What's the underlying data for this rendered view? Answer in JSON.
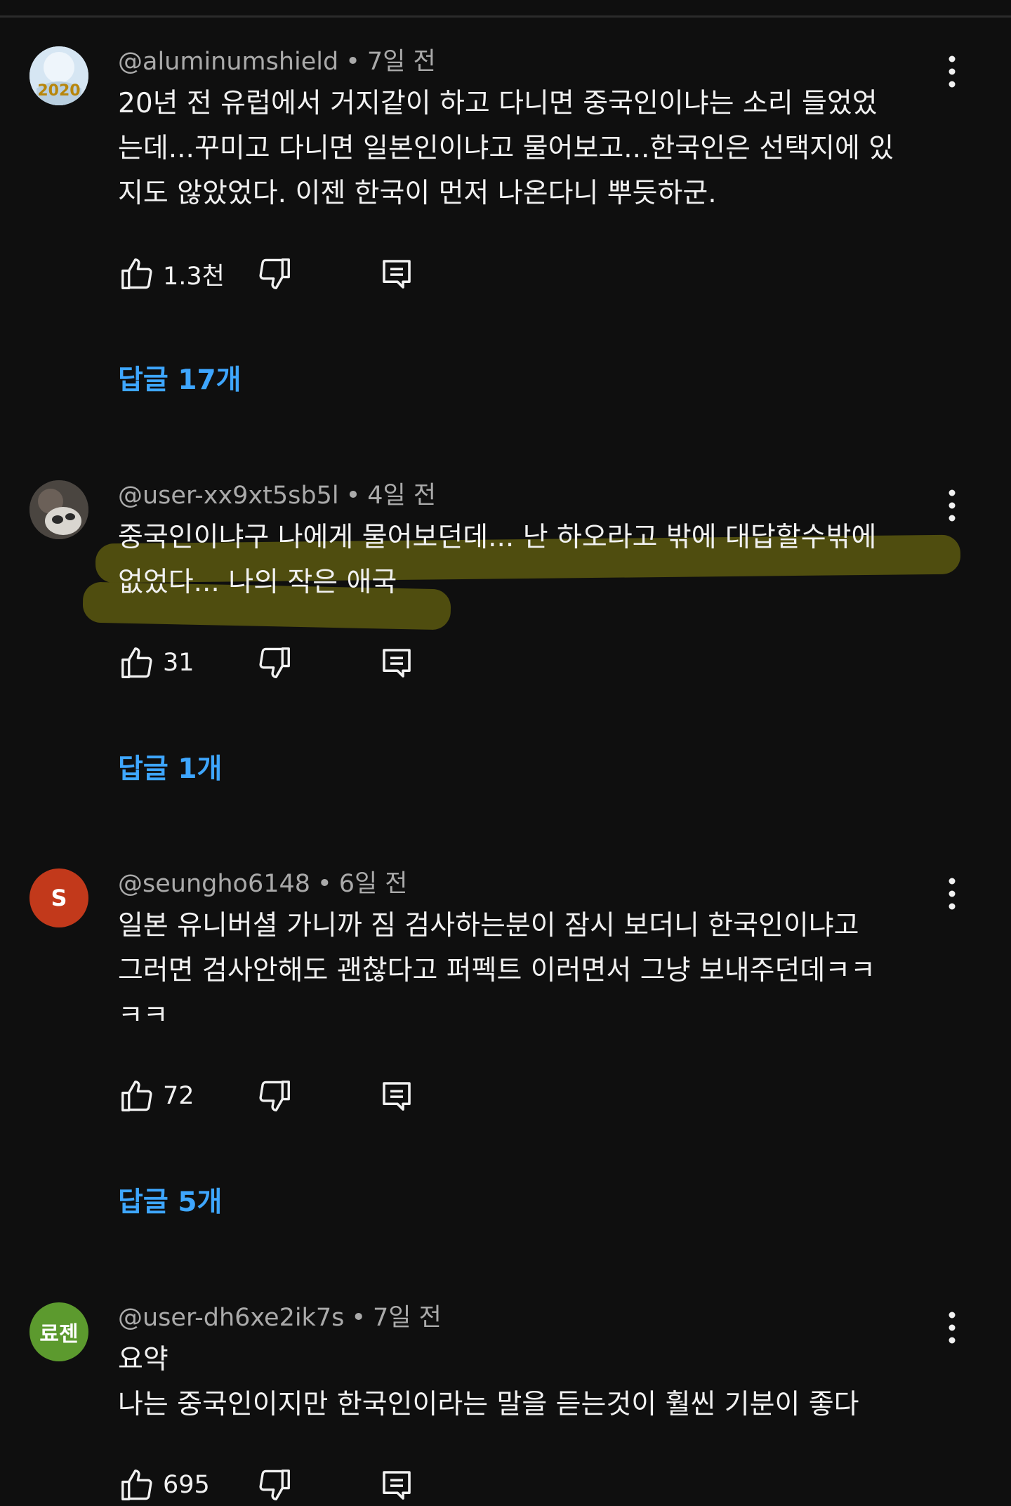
{
  "colors": {
    "background": "#0f0f0f",
    "text": "#f1f1f1",
    "meta": "#aaaaaa",
    "link": "#3ea6ff",
    "highlight": "#4f4d0f"
  },
  "comments": [
    {
      "author": "@aluminumshield",
      "separator": "•",
      "time": "7일 전",
      "text_lines": [
        "20년 전 유럽에서 거지같이 하고 다니면 중국인이냐는 소리 들었었",
        "는데...꾸미고 다니면 일본인이냐고 물어보고...한국인은 선택지에 있",
        "지도 않았었다. 이젠 한국이 먼저 나온다니 뿌듯하군."
      ],
      "likes": "1.3천",
      "replies": "답글 17개",
      "avatar_text": "2020",
      "icons": [
        "like-icon",
        "dislike-icon",
        "reply-icon",
        "more-vert-icon"
      ]
    },
    {
      "author": "@user-xx9xt5sb5l",
      "separator": "•",
      "time": "4일 전",
      "text_lines": [
        "중국인이냐구 나에게 물어보던데... 난 하오라고 밖에 대답할수밖에",
        "없었다... 나의 작은 애국"
      ],
      "likes": "31",
      "replies": "답글 1개",
      "highlighted": true,
      "icons": [
        "like-icon",
        "dislike-icon",
        "reply-icon",
        "more-vert-icon"
      ]
    },
    {
      "author": "@seungho6148",
      "separator": "•",
      "time": "6일 전",
      "text_lines": [
        "일본 유니버셜 가니까 짐 검사하는분이 잠시 보더니 한국인이냐고",
        "그러면 검사안해도 괜찮다고 퍼펙트 이러면서 그냥 보내주던데ㅋㅋ",
        "ㅋㅋ"
      ],
      "likes": "72",
      "replies": "답글 5개",
      "avatar_text": "S",
      "avatar_color": "#c2391b",
      "icons": [
        "like-icon",
        "dislike-icon",
        "reply-icon",
        "more-vert-icon"
      ]
    },
    {
      "author": "@user-dh6xe2ik7s",
      "separator": "•",
      "time": "7일 전",
      "text_lines": [
        "요약",
        "나는 중국인이지만 한국인이라는 말을 듣는것이 훨씬 기분이 좋다"
      ],
      "likes": "695",
      "avatar_text": "료젠",
      "avatar_color": "#5c9a2e",
      "icons": [
        "like-icon",
        "dislike-icon",
        "reply-icon",
        "more-vert-icon"
      ]
    }
  ]
}
